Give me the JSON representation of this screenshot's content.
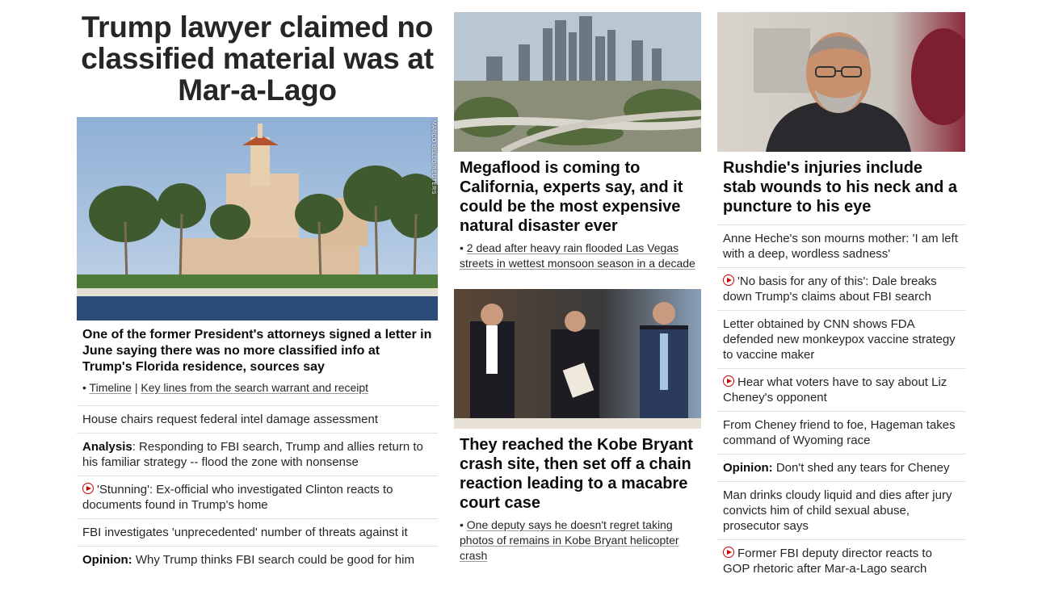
{
  "left": {
    "headline": "Trump lawyer claimed no classified material was at Mar-a-Lago",
    "image_credit": "MARCO BELLO/REUTERS",
    "subheadline": "One of the former President's attorneys signed a letter in June saying there was no more classified info at Trump's Florida residence, sources say",
    "related_prefix": "•",
    "related_links": [
      "Timeline",
      "Key lines from the search warrant and receipt"
    ],
    "related_sep": "|",
    "list": [
      {
        "prefix": "",
        "text": "House chairs request federal intel damage assessment",
        "video": false
      },
      {
        "prefix": "Analysis",
        "text": ": Responding to FBI search, Trump and allies return to his familiar strategy -- flood the zone with nonsense",
        "video": false
      },
      {
        "prefix": "",
        "text": "'Stunning': Ex-official who investigated Clinton reacts to documents found in Trump's home",
        "video": true
      },
      {
        "prefix": "",
        "text": "FBI investigates 'unprecedented' number of threats against it",
        "video": false
      },
      {
        "prefix": "Opinion:",
        "text": " Why Trump thinks FBI search could be good for him",
        "video": false
      }
    ]
  },
  "middle": {
    "story1": {
      "headline": "Megaflood is coming to California, experts say, and it could be the most expensive natural disaster ever",
      "related": "2 dead after heavy rain flooded Las Vegas streets in wettest monsoon season in a decade"
    },
    "story2": {
      "headline": "They reached the Kobe Bryant crash site, then set off a chain reaction leading to a macabre court case",
      "related": "One deputy says he doesn't regret taking photos of remains in Kobe Bryant helicopter crash"
    },
    "bullet": "•"
  },
  "right": {
    "headline": "Rushdie's injuries include stab wounds to his neck and a puncture to his eye",
    "list": [
      {
        "prefix": "",
        "text": "Anne Heche's son mourns mother: 'I am left with a deep, wordless sadness'",
        "video": false
      },
      {
        "prefix": "",
        "text": "'No basis for any of this': Dale breaks down Trump's claims about FBI search",
        "video": true
      },
      {
        "prefix": "",
        "text": "Letter obtained by CNN shows FDA defended new monkeypox vaccine strategy to vaccine maker",
        "video": false
      },
      {
        "prefix": "",
        "text": "Hear what voters have to say about Liz Cheney's opponent",
        "video": true
      },
      {
        "prefix": "",
        "text": "From Cheney friend to foe, Hageman takes command of Wyoming race",
        "video": false
      },
      {
        "prefix": "Opinion:",
        "text": " Don't shed any tears for Cheney",
        "video": false
      },
      {
        "prefix": "",
        "text": "Man drinks cloudy liquid and dies after jury convicts him of child sexual abuse, prosecutor says",
        "video": false
      },
      {
        "prefix": "",
        "text": "Former FBI deputy director reacts to GOP rhetoric after Mar-a-Lago search",
        "video": true
      }
    ]
  },
  "colors": {
    "video_icon": "#cc0000",
    "divider": "#e0e0e0",
    "text": "#0c0c0c"
  }
}
